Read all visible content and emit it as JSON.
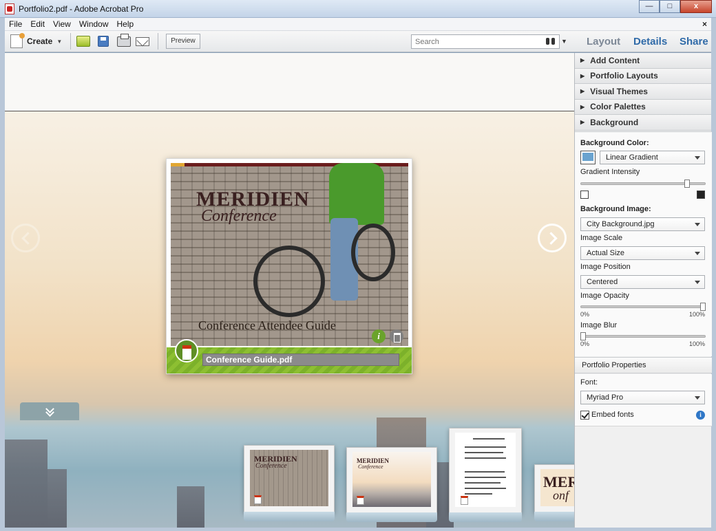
{
  "window": {
    "title": "Portfolio2.pdf - Adobe Acrobat Pro",
    "buttons": {
      "minimize": "—",
      "maximize": "□",
      "close": "x"
    }
  },
  "menu": {
    "items": [
      "File",
      "Edit",
      "View",
      "Window",
      "Help"
    ],
    "close": "×"
  },
  "toolbar": {
    "create_label": "Create",
    "preview_label": "Preview",
    "search_placeholder": "Search",
    "modes": {
      "layout": "Layout",
      "details": "Details",
      "share": "Share"
    }
  },
  "canvas": {
    "card": {
      "brand": "MERIDIEN",
      "brand_sub": "Conference",
      "guide_title": "Conference Attendee Guide",
      "info_label": "i",
      "filename": "Conference Guide.pdf"
    },
    "thumbnails": [
      {
        "brand": "MERIDIEN",
        "brand_sub": "Conference"
      },
      {
        "brand": "MERIDIEN",
        "brand_sub": "Conference"
      },
      {
        "brand": ""
      },
      {
        "brand": "MER",
        "brand_sub": "onf"
      }
    ]
  },
  "panel": {
    "sections": [
      "Add Content",
      "Portfolio Layouts",
      "Visual Themes",
      "Color Palettes",
      "Background"
    ],
    "background": {
      "color_label": "Background Color:",
      "color_mode": "Linear Gradient",
      "gradient_label": "Gradient Intensity",
      "gradient_value": 0.87,
      "image_label": "Background Image:",
      "image_value": "City Background.jpg",
      "scale_label": "Image Scale",
      "scale_value": "Actual Size",
      "position_label": "Image Position",
      "position_value": "Centered",
      "opacity_label": "Image Opacity",
      "opacity_value": 1.0,
      "opacity_min": "0%",
      "opacity_max": "100%",
      "blur_label": "Image Blur",
      "blur_value": 0.0,
      "blur_min": "0%",
      "blur_max": "100%"
    },
    "properties": {
      "header": "Portfolio Properties",
      "font_label": "Font:",
      "font_value": "Myriad Pro",
      "embed_label": "Embed fonts",
      "embed_checked": true,
      "info_glyph": "i"
    }
  },
  "colors": {
    "accent_blue": "#2f6aa8",
    "card_green": "#8dbf32",
    "brand_dark": "#3a2020",
    "swatch": "#6aa3cf"
  }
}
